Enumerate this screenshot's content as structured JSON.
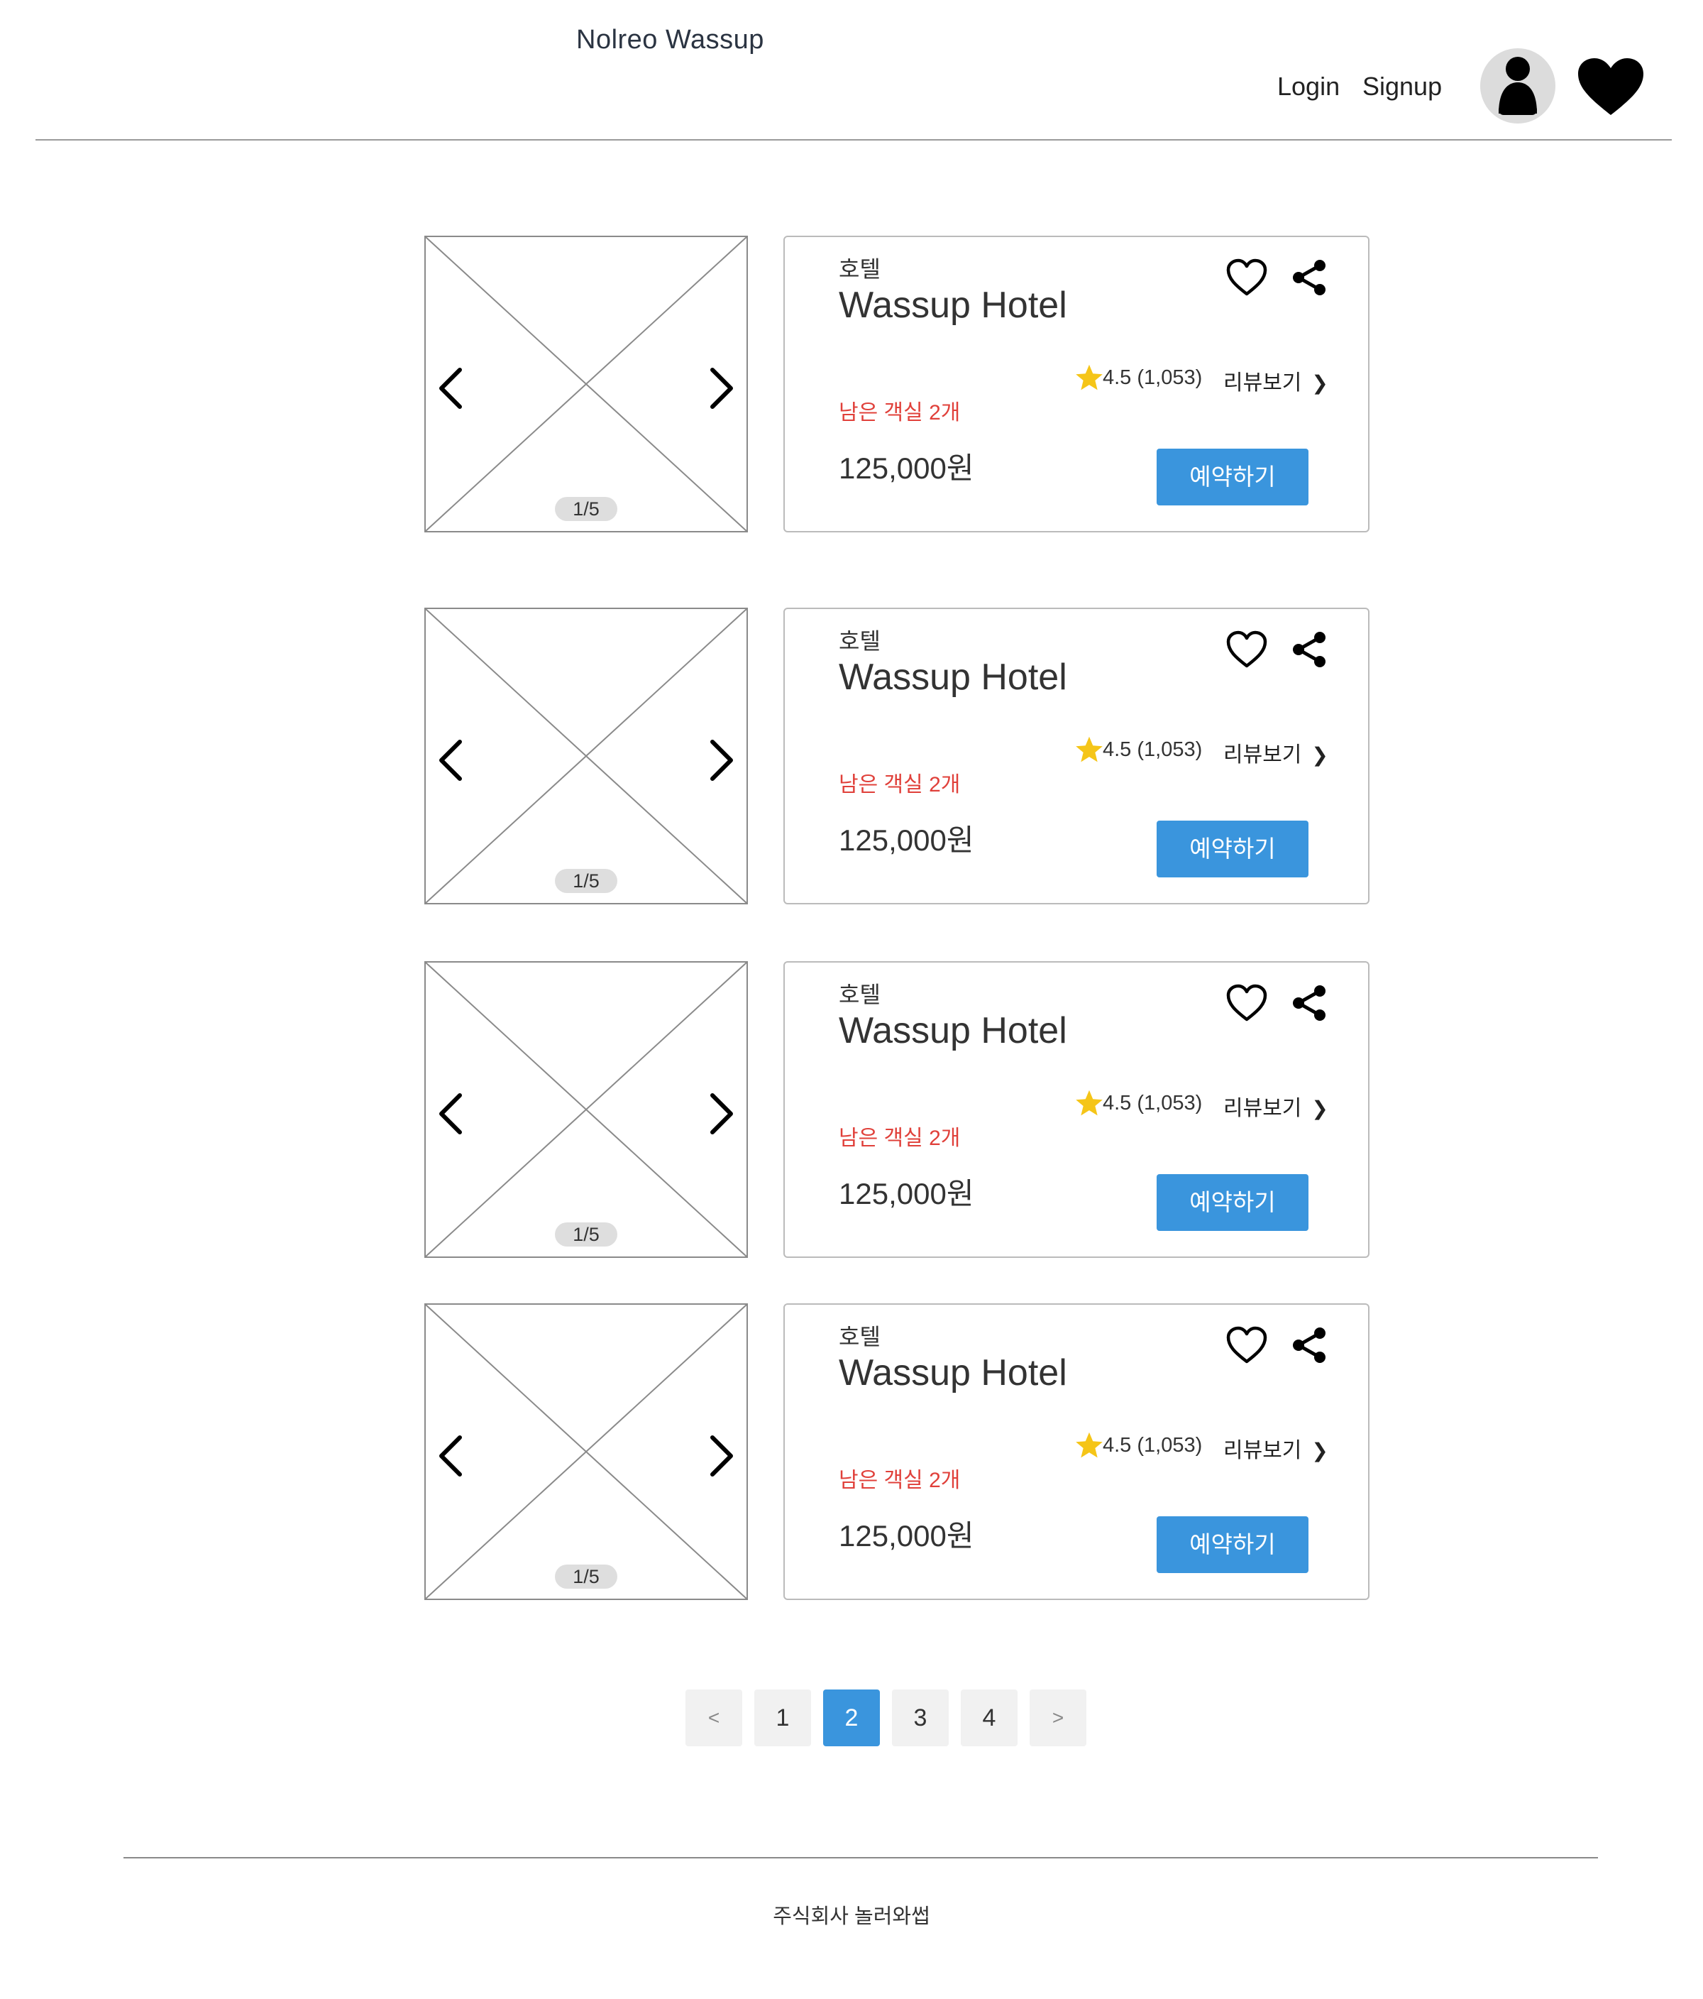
{
  "header": {
    "site_title": "Nolreo Wassup",
    "login_label": "Login",
    "signup_label": "Signup",
    "avatar_icon": "user-avatar-icon",
    "favorites_icon": "heart-filled-icon"
  },
  "listings": [
    {
      "image_counter": "1/5",
      "category": "호텔",
      "name": "Wassup Hotel",
      "rating_text": "4.5 (1,053)",
      "rating": 4.5,
      "review_count": 1053,
      "reviews_label": "리뷰보기",
      "rooms_left": "남은 객실 2개",
      "price": "125,000원",
      "book_label": "예약하기"
    },
    {
      "image_counter": "1/5",
      "category": "호텔",
      "name": "Wassup Hotel",
      "rating_text": "4.5 (1,053)",
      "rating": 4.5,
      "review_count": 1053,
      "reviews_label": "리뷰보기",
      "rooms_left": "남은 객실 2개",
      "price": "125,000원",
      "book_label": "예약하기"
    },
    {
      "image_counter": "1/5",
      "category": "호텔",
      "name": "Wassup Hotel",
      "rating_text": "4.5 (1,053)",
      "rating": 4.5,
      "review_count": 1053,
      "reviews_label": "리뷰보기",
      "rooms_left": "남은 객실 2개",
      "price": "125,000원",
      "book_label": "예약하기"
    },
    {
      "image_counter": "1/5",
      "category": "호텔",
      "name": "Wassup Hotel",
      "rating_text": "4.5 (1,053)",
      "rating": 4.5,
      "review_count": 1053,
      "reviews_label": "리뷰보기",
      "rooms_left": "남은 객실 2개",
      "price": "125,000원",
      "book_label": "예약하기"
    }
  ],
  "pagination": {
    "prev_label": "<",
    "pages": [
      "1",
      "2",
      "3",
      "4"
    ],
    "current_page": "2",
    "next_label": ">"
  },
  "footer": {
    "company_text": "주식회사 놀러와썹"
  },
  "colors": {
    "accent": "#3a95dd",
    "rooms_left": "#e0403a",
    "star": "#f5c518"
  }
}
